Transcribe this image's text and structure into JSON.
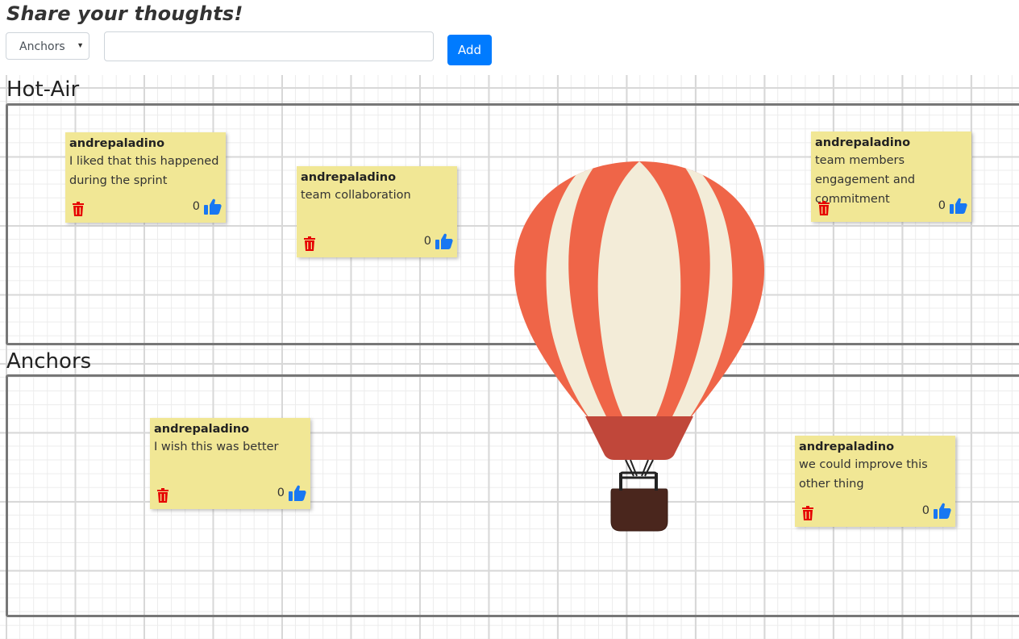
{
  "header": {
    "title": "Share your thoughts!"
  },
  "form": {
    "category_selected": "Anchors",
    "category_options": [
      "Hot-Air",
      "Anchors"
    ],
    "thought_value": "",
    "thought_placeholder": "",
    "add_label": "Add"
  },
  "sections": {
    "hot_air": {
      "title": "Hot-Air"
    },
    "anchors": {
      "title": "Anchors"
    }
  },
  "notes": {
    "n1": {
      "author": "andrepaladino",
      "text": "I liked that this happened during the sprint",
      "likes": "0"
    },
    "n2": {
      "author": "andrepaladino",
      "text": "team collaboration",
      "likes": "0"
    },
    "n3": {
      "author": "andrepaladino",
      "text": "team members engagement and commitment",
      "likes": "0"
    },
    "n4": {
      "author": "andrepaladino",
      "text": "I wish this was better",
      "likes": "0"
    },
    "n5": {
      "author": "andrepaladino",
      "text": "we could improve this other thing",
      "likes": "0"
    }
  },
  "colors": {
    "note_bg": "#f1e795",
    "add_button": "#007bff",
    "trash": "#e60000",
    "thumb": "#1877f2",
    "balloon_stripe": "#ef6548",
    "balloon_cream": "#f3ecd8",
    "basket": "#4a261d"
  },
  "icons": {
    "delete": "trash-icon",
    "like": "thumbs-up-icon",
    "decor": "hot-air-balloon-illustration"
  }
}
